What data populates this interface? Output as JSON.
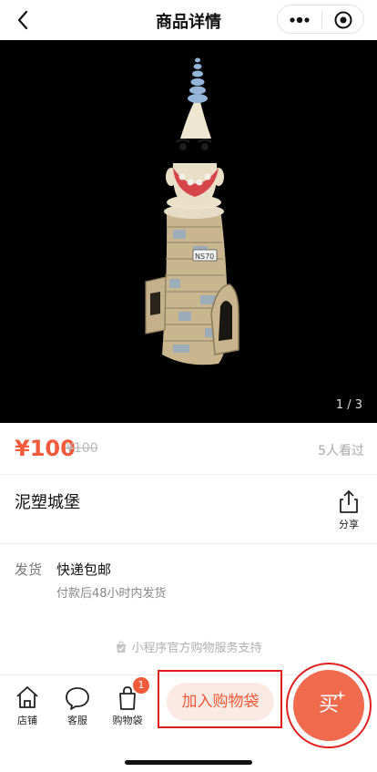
{
  "header": {
    "title": "商品详情",
    "icons": [
      "back-icon",
      "more-icon",
      "close-target-icon"
    ]
  },
  "gallery": {
    "counter": "1 / 3"
  },
  "product": {
    "price": "¥100",
    "original_price": "¥100",
    "views": "5人看过",
    "name": "泥塑城堡",
    "share_label": "分享"
  },
  "shipping": {
    "label": "发货",
    "value": "快递包邮",
    "note": "付款后48小时内发货"
  },
  "support_text": "小程序官方购物服务支持",
  "bottom_bar": {
    "store_label": "店铺",
    "service_label": "客服",
    "cart_label": "购物袋",
    "cart_badge": "1",
    "add_cart_label": "加入购物袋",
    "buy_label": "买"
  },
  "colors": {
    "accent": "#f15a3a",
    "highlight_outline": "#e21e1e"
  }
}
